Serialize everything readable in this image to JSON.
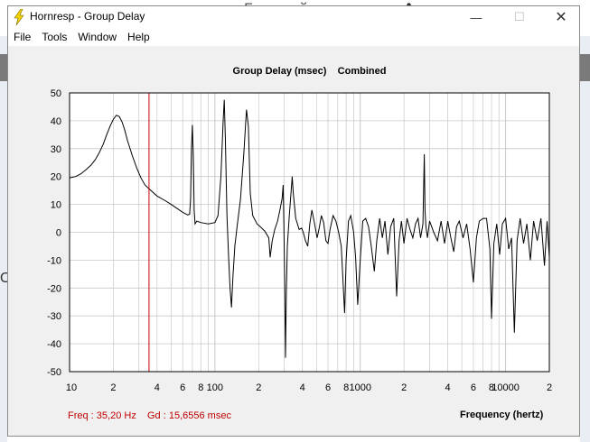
{
  "background": {
    "top_text": "Быстрый переход",
    "top_bold_text": "Акустическ",
    "left_char": "O"
  },
  "window": {
    "title": "Hornresp - Group Delay",
    "controls": {
      "minimize": "—",
      "maximize": "☐",
      "close": "✕"
    }
  },
  "menu": {
    "items": [
      "File",
      "Tools",
      "Window",
      "Help"
    ]
  },
  "status": {
    "freq": "Freq : 35,20 Hz",
    "gd": "Gd : 15,6556 msec"
  },
  "colors": {
    "cursor": "#cc0000",
    "trace": "#000000",
    "grid": "#c0c0c0",
    "status_text": "#c00000"
  },
  "chart_data": {
    "type": "line",
    "title": "Group Delay (msec)    Combined",
    "xlabel": "Frequency (hertz)",
    "ylabel": "",
    "x_scale": "log",
    "xlim": [
      10,
      20000
    ],
    "ylim": [
      -50,
      50
    ],
    "y_ticks": [
      50,
      40,
      30,
      20,
      10,
      0,
      -10,
      -20,
      -30,
      -40,
      -50
    ],
    "x_tick_labels": [
      {
        "value": 10,
        "label": "10"
      },
      {
        "value": 20,
        "label": "2"
      },
      {
        "value": 40,
        "label": "4"
      },
      {
        "value": 60,
        "label": "6"
      },
      {
        "value": 80,
        "label": "8"
      },
      {
        "value": 100,
        "label": "100"
      },
      {
        "value": 200,
        "label": "2"
      },
      {
        "value": 400,
        "label": "4"
      },
      {
        "value": 600,
        "label": "6"
      },
      {
        "value": 800,
        "label": "8"
      },
      {
        "value": 1000,
        "label": "1000"
      },
      {
        "value": 2000,
        "label": "2"
      },
      {
        "value": 4000,
        "label": "4"
      },
      {
        "value": 6000,
        "label": "6"
      },
      {
        "value": 8000,
        "label": "8"
      },
      {
        "value": 10000,
        "label": "10000"
      },
      {
        "value": 20000,
        "label": "2"
      }
    ],
    "grid": true,
    "cursor_freq": 35.2,
    "series": [
      {
        "points": [
          [
            10,
            19.5
          ],
          [
            11,
            20
          ],
          [
            12,
            21
          ],
          [
            13,
            22.5
          ],
          [
            14,
            24
          ],
          [
            15,
            26
          ],
          [
            16,
            28.5
          ],
          [
            17,
            31.5
          ],
          [
            18,
            35
          ],
          [
            19,
            38
          ],
          [
            20,
            40.5
          ],
          [
            21,
            42
          ],
          [
            22,
            41.5
          ],
          [
            23,
            39.5
          ],
          [
            24,
            36.5
          ],
          [
            25,
            33
          ],
          [
            27,
            27.5
          ],
          [
            29,
            23
          ],
          [
            31,
            19.5
          ],
          [
            33,
            17
          ],
          [
            35.2,
            15.6
          ],
          [
            40,
            13
          ],
          [
            45,
            11.5
          ],
          [
            50,
            10
          ],
          [
            55,
            8.5
          ],
          [
            60,
            7.2
          ],
          [
            65,
            6.2
          ],
          [
            67,
            6.5
          ],
          [
            68,
            12
          ],
          [
            69,
            30
          ],
          [
            70,
            38.5
          ],
          [
            71,
            28
          ],
          [
            72,
            8
          ],
          [
            73,
            3
          ],
          [
            75,
            4
          ],
          [
            80,
            3.5
          ],
          [
            90,
            3
          ],
          [
            100,
            3.5
          ],
          [
            105,
            6
          ],
          [
            110,
            20
          ],
          [
            114,
            40
          ],
          [
            116,
            47.5
          ],
          [
            118,
            34
          ],
          [
            121,
            6
          ],
          [
            124,
            -8
          ],
          [
            127,
            -20
          ],
          [
            130,
            -27
          ],
          [
            133,
            -16
          ],
          [
            137,
            -5
          ],
          [
            142,
            2
          ],
          [
            150,
            12
          ],
          [
            158,
            28
          ],
          [
            165,
            44
          ],
          [
            170,
            38
          ],
          [
            175,
            14
          ],
          [
            182,
            6
          ],
          [
            195,
            3
          ],
          [
            205,
            2
          ],
          [
            220,
            0.5
          ],
          [
            235,
            -2
          ],
          [
            240,
            -9
          ],
          [
            248,
            -3
          ],
          [
            258,
            1
          ],
          [
            270,
            4
          ],
          [
            280,
            8
          ],
          [
            290,
            12
          ],
          [
            295,
            17
          ],
          [
            298,
            5
          ],
          [
            302,
            -18
          ],
          [
            306,
            -45
          ],
          [
            310,
            -22
          ],
          [
            315,
            -5
          ],
          [
            325,
            6
          ],
          [
            335,
            15
          ],
          [
            340,
            20
          ],
          [
            346,
            14
          ],
          [
            360,
            5
          ],
          [
            380,
            1
          ],
          [
            395,
            1.5
          ],
          [
            405,
            0
          ],
          [
            420,
            -3
          ],
          [
            435,
            -5
          ],
          [
            450,
            3
          ],
          [
            465,
            8
          ],
          [
            485,
            3
          ],
          [
            505,
            -2
          ],
          [
            520,
            1
          ],
          [
            540,
            6
          ],
          [
            560,
            3.5
          ],
          [
            580,
            -3
          ],
          [
            600,
            -4
          ],
          [
            620,
            1
          ],
          [
            650,
            6
          ],
          [
            680,
            4
          ],
          [
            710,
            0
          ],
          [
            740,
            -5
          ],
          [
            780,
            -29
          ],
          [
            800,
            -10
          ],
          [
            830,
            4
          ],
          [
            860,
            6
          ],
          [
            900,
            0
          ],
          [
            930,
            -9
          ],
          [
            960,
            -26
          ],
          [
            1000,
            -10
          ],
          [
            1040,
            4
          ],
          [
            1090,
            5
          ],
          [
            1140,
            2
          ],
          [
            1190,
            -5
          ],
          [
            1250,
            -14
          ],
          [
            1300,
            -3
          ],
          [
            1360,
            5
          ],
          [
            1420,
            -2
          ],
          [
            1480,
            4
          ],
          [
            1550,
            -8
          ],
          [
            1620,
            2
          ],
          [
            1700,
            5
          ],
          [
            1780,
            -23
          ],
          [
            1850,
            -3
          ],
          [
            1920,
            4
          ],
          [
            2000,
            -4
          ],
          [
            2100,
            5
          ],
          [
            2200,
            1
          ],
          [
            2300,
            -2
          ],
          [
            2400,
            3
          ],
          [
            2500,
            5
          ],
          [
            2600,
            -2
          ],
          [
            2700,
            3
          ],
          [
            2760,
            28
          ],
          [
            2790,
            8
          ],
          [
            2830,
            2
          ],
          [
            2900,
            -2
          ],
          [
            3000,
            4
          ],
          [
            3200,
            0
          ],
          [
            3400,
            -3
          ],
          [
            3600,
            4
          ],
          [
            3800,
            -4
          ],
          [
            4000,
            4
          ],
          [
            4200,
            -2
          ],
          [
            4400,
            -7
          ],
          [
            4600,
            2
          ],
          [
            4800,
            4
          ],
          [
            5100,
            -2
          ],
          [
            5400,
            3
          ],
          [
            5700,
            -6
          ],
          [
            6000,
            -18
          ],
          [
            6300,
            -2
          ],
          [
            6600,
            4
          ],
          [
            7000,
            5
          ],
          [
            7400,
            5
          ],
          [
            7800,
            -6
          ],
          [
            8000,
            -31
          ],
          [
            8300,
            -4
          ],
          [
            8700,
            3
          ],
          [
            9100,
            -8
          ],
          [
            9500,
            3
          ],
          [
            10000,
            5
          ],
          [
            10500,
            -6
          ],
          [
            11000,
            -2
          ],
          [
            11500,
            -36
          ],
          [
            12000,
            -3
          ],
          [
            12600,
            5
          ],
          [
            13300,
            -4
          ],
          [
            14000,
            3
          ],
          [
            14800,
            -10
          ],
          [
            15600,
            4
          ],
          [
            16500,
            -3
          ],
          [
            17500,
            5
          ],
          [
            18500,
            -12
          ],
          [
            19300,
            4
          ],
          [
            20000,
            -9
          ]
        ]
      }
    ]
  }
}
